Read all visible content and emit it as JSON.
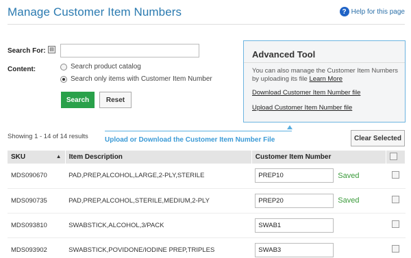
{
  "header": {
    "title": "Manage Customer Item Numbers",
    "help_label": "Help for this page",
    "help_icon": "question-circle-icon"
  },
  "search": {
    "label": "Search For:",
    "value": "",
    "placeholder": ""
  },
  "content": {
    "label": "Content:",
    "options": [
      {
        "label": "Search product catalog",
        "checked": false
      },
      {
        "label": "Search only items with Customer Item Number",
        "checked": true
      }
    ]
  },
  "buttons": {
    "search": "Search",
    "reset": "Reset",
    "clear_selected": "Clear Selected"
  },
  "advanced": {
    "title": "Advanced Tool",
    "desc_prefix": "You can also manage the Customer Item Numbers by uploading its file",
    "learn_more": "Learn More",
    "download_link": "Download Customer Item Number file",
    "upload_link": "Upload Customer Item Number file"
  },
  "results": {
    "showing": "Showing 1 - 14 of 14 results",
    "callout": "Upload or Download the Customer Item Number File"
  },
  "table": {
    "headers": {
      "sku": "SKU",
      "description": "Item Description",
      "cin": "Customer Item Number"
    },
    "rows": [
      {
        "sku": "MDS090670",
        "description": "PAD,PREP,ALCOHOL,LARGE,2-PLY,STERILE",
        "cin": "PREP10",
        "status": "Saved"
      },
      {
        "sku": "MDS090735",
        "description": "PAD,PREP,ALCOHOL,STERILE,MEDIUM,2-PLY",
        "cin": "PREP20",
        "status": "Saved"
      },
      {
        "sku": "MDS093810",
        "description": "SWABSTICK,ALCOHOL,3/PACK",
        "cin": "SWAB1",
        "status": ""
      },
      {
        "sku": "MDS093902",
        "description": "SWABSTICK,POVIDONE/IODINE PREP,TRIPLES",
        "cin": "SWAB3",
        "status": ""
      }
    ]
  },
  "colors": {
    "title": "#2a7ab0",
    "accent_green": "#29a14a",
    "saved": "#3a9a3a",
    "panel_border": "#6cb4e0"
  }
}
